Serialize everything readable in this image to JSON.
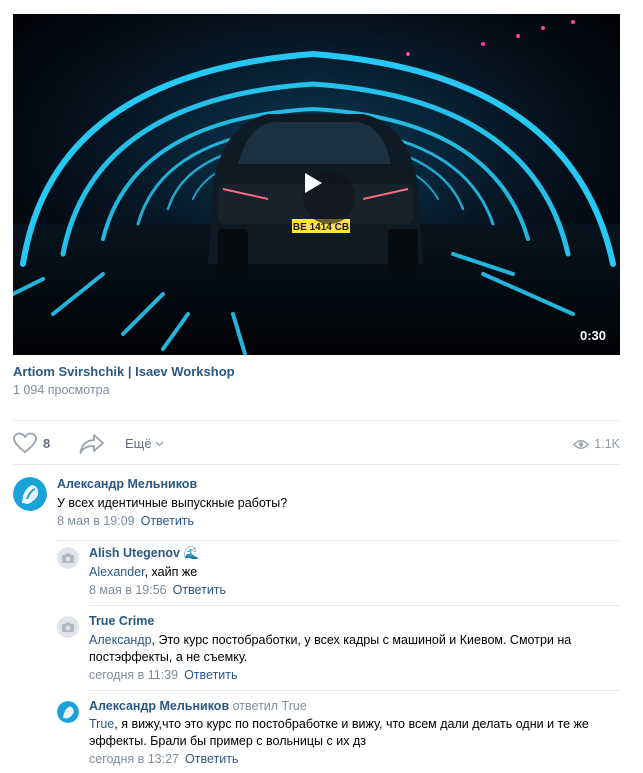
{
  "video": {
    "duration": "0:30",
    "plate": "BE 1414 CB",
    "title": "Artiom Svirshchik | Isaev Workshop",
    "views": "1 094 просмотра"
  },
  "actions": {
    "likes": "8",
    "more_label": "Ещё",
    "view_count": "1.1K"
  },
  "comments": [
    {
      "author": "Александр Мельников",
      "text": "У всех идентичные выпускные работы?",
      "date": "8 мая в 19:09",
      "reply_label": "Ответить"
    }
  ],
  "replies": [
    {
      "author": "Alish Utegenov 🌊",
      "mention": "Alexander",
      "text": ", хайп же",
      "date": "8 мая в 19:56",
      "reply_label": "Ответить"
    },
    {
      "author": "True Crime",
      "mention": "Александр",
      "text_line1": ", Это курс постобработки, у всех кадры с машиной и Киевом. Смотри на",
      "text_line2": "постэффекты, а не съемку.",
      "date": "сегодня в 11:39",
      "reply_label": "Ответить"
    },
    {
      "author": "Александр Мельников",
      "replied_to": "ответил True",
      "mention": "True",
      "text_line1": ", я вижу,что это курс по постобработке и вижу, что всем дали делать одни и те же",
      "text_line2": "эффекты. Брали бы пример с вольницы с их дз",
      "date": "сегодня в 13:27",
      "reply_label": "Ответить"
    }
  ],
  "colors": {
    "link": "#2a5885",
    "secondary": "#818c99",
    "divider": "#e7e8ec",
    "neon": "#29d3ff"
  }
}
